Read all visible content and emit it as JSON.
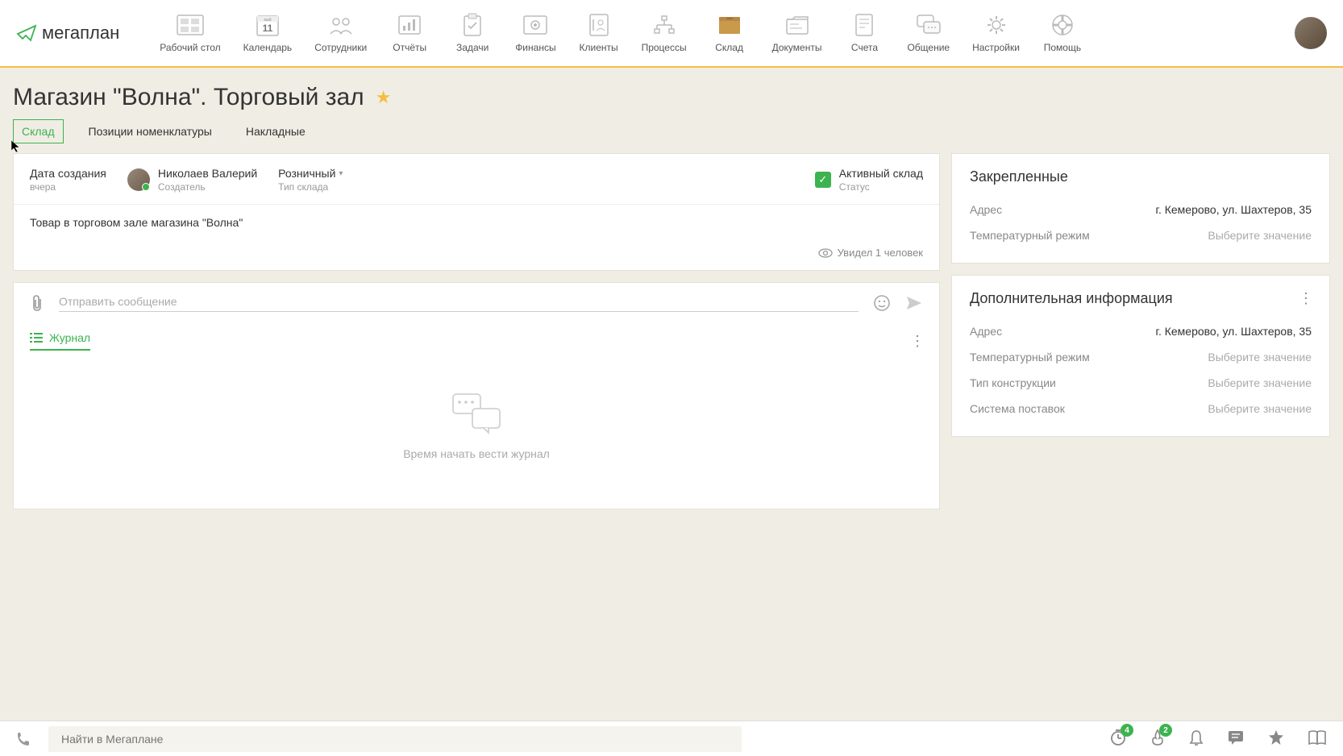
{
  "logo": "мегаплан",
  "nav_items": [
    {
      "label": "Рабочий стол"
    },
    {
      "label": "Календарь",
      "day": "11",
      "month": "май"
    },
    {
      "label": "Сотрудники"
    },
    {
      "label": "Отчёты"
    },
    {
      "label": "Задачи"
    },
    {
      "label": "Финансы"
    },
    {
      "label": "Клиенты"
    },
    {
      "label": "Процессы"
    },
    {
      "label": "Склад"
    },
    {
      "label": "Документы"
    },
    {
      "label": "Счета"
    },
    {
      "label": "Общение"
    },
    {
      "label": "Настройки"
    },
    {
      "label": "Помощь"
    }
  ],
  "page_title": "Магазин \"Волна\". Торговый зал",
  "tabs": [
    {
      "label": "Склад",
      "active": true
    },
    {
      "label": "Позиции номенклатуры"
    },
    {
      "label": "Накладные"
    }
  ],
  "info": {
    "created_label": "Дата создания",
    "created_value": "вчера",
    "creator_name": "Николаев Валерий",
    "creator_role": "Создатель",
    "type_value": "Розничный",
    "type_label": "Тип склада",
    "status_value": "Активный склад",
    "status_label": "Статус"
  },
  "description": "Товар в торговом зале магазина \"Волна\"",
  "views_text": "Увидел 1 человек",
  "message_placeholder": "Отправить сообщение",
  "journal_label": "Журнал",
  "journal_empty": "Время начать вести журнал",
  "pinned": {
    "title": "Закрепленные",
    "rows": [
      {
        "key": "Адрес",
        "value": "г. Кемерово, ул. Шахтеров, 35"
      },
      {
        "key": "Температурный режим",
        "placeholder": "Выберите значение"
      }
    ]
  },
  "extra": {
    "title": "Дополнительная информация",
    "rows": [
      {
        "key": "Адрес",
        "value": "г. Кемерово, ул. Шахтеров, 35"
      },
      {
        "key": "Температурный режим",
        "placeholder": "Выберите значение"
      },
      {
        "key": "Тип конструкции",
        "placeholder": "Выберите значение"
      },
      {
        "key": "Система поставок",
        "placeholder": "Выберите значение"
      }
    ]
  },
  "search_placeholder": "Найти в Мегаплане",
  "badges": {
    "timer": "4",
    "fire": "2"
  }
}
